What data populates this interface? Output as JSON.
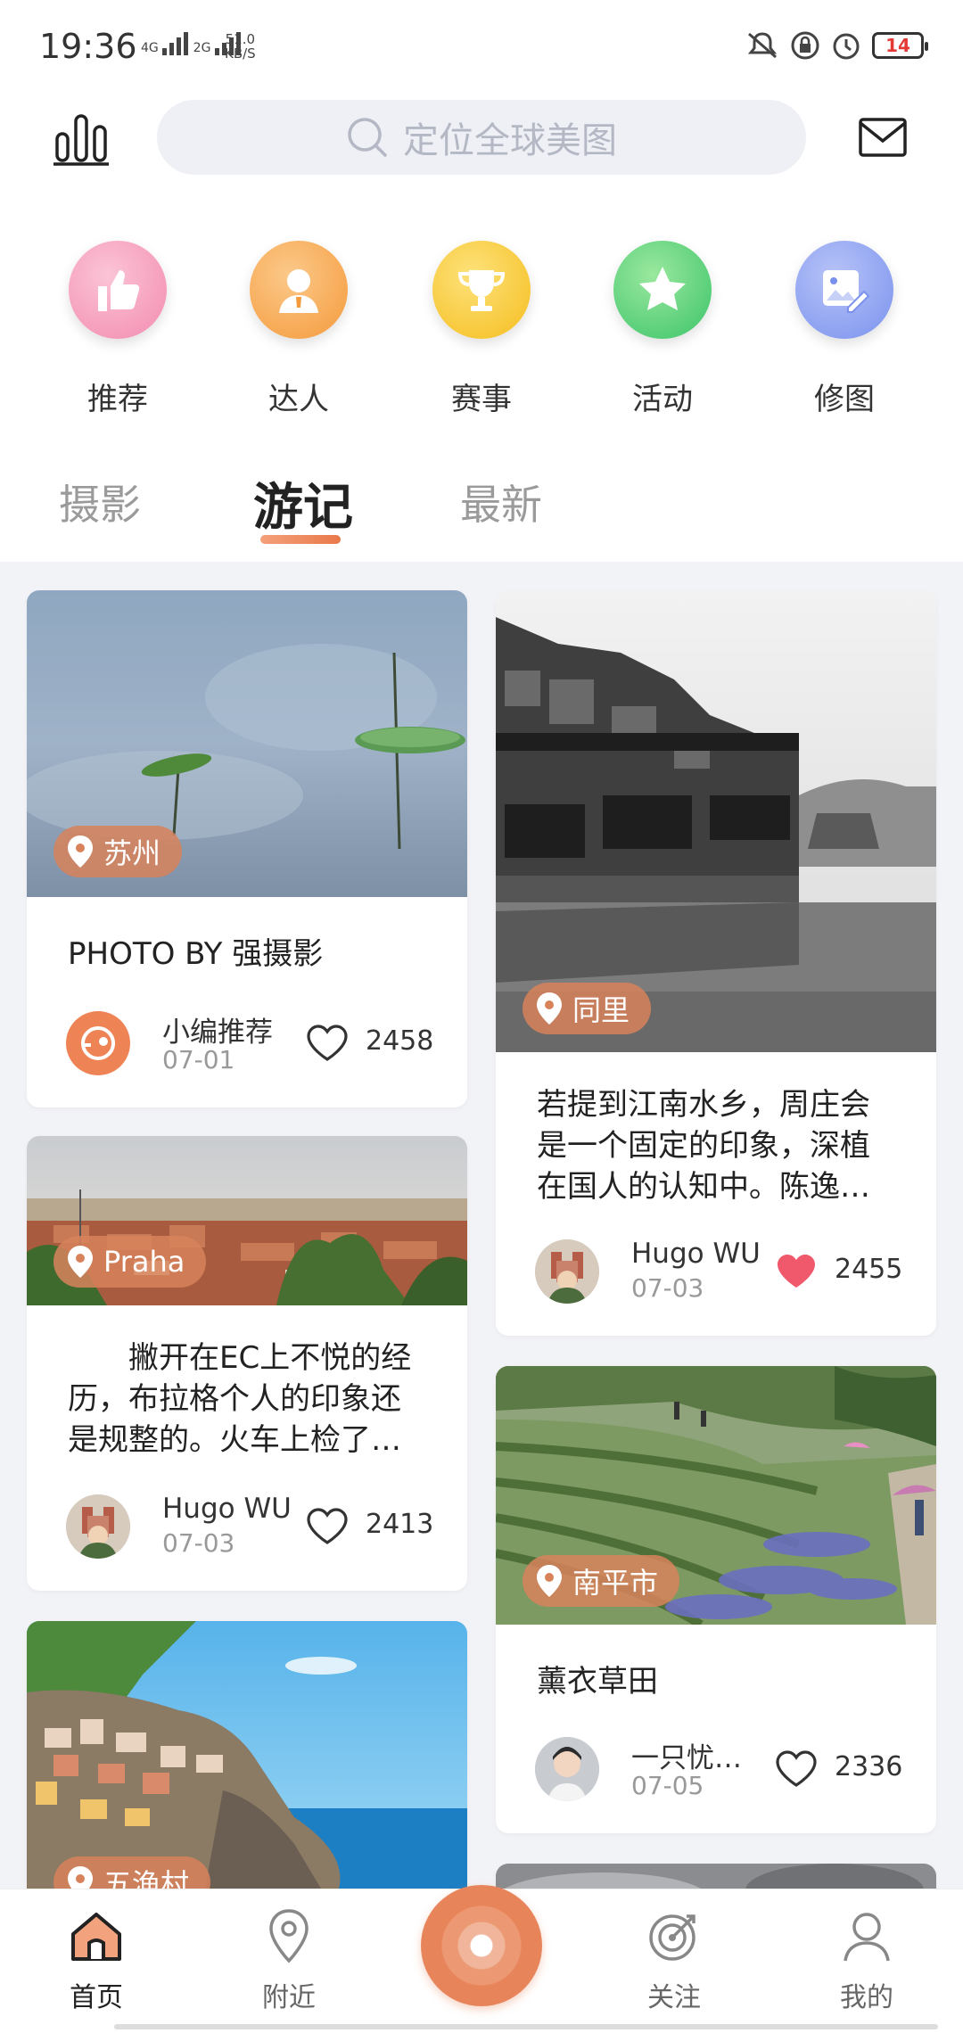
{
  "status_bar": {
    "time": "19:36",
    "network_left": "4G",
    "network_right": "2G",
    "speed_value": "51.0",
    "speed_unit": "KB/S",
    "battery": "14"
  },
  "header": {
    "search_placeholder": "定位全球美图"
  },
  "categories": [
    {
      "label": "推荐",
      "icon": "thumbs-up-icon",
      "color": "#f48fb1"
    },
    {
      "label": "达人",
      "icon": "person-icon",
      "color": "#f7a04b"
    },
    {
      "label": "赛事",
      "icon": "trophy-icon",
      "color": "#f7c531"
    },
    {
      "label": "活动",
      "icon": "star-icon",
      "color": "#4ccd6a"
    },
    {
      "label": "修图",
      "icon": "photo-edit-icon",
      "color": "#7d9bef"
    }
  ],
  "tabs": [
    {
      "label": "摄影"
    },
    {
      "label": "游记",
      "active": true
    },
    {
      "label": "最新"
    }
  ],
  "feed": {
    "left": [
      {
        "location": "苏州",
        "title": "PHOTO BY 强摄影",
        "author": "小编推荐",
        "date": "07-01",
        "likes": "2458",
        "liked": false
      },
      {
        "location": "Praha",
        "text": "　　撇开在EC上不悦的经历，布拉格个人的印象还是规整的。火车上检了…",
        "author": "Hugo WU",
        "date": "07-03",
        "likes": "2413",
        "liked": false
      },
      {
        "location": "五渔村"
      }
    ],
    "right": [
      {
        "location": "同里",
        "text": "若提到江南水乡，周庄会是一个固定的印象，深植在国人的认知中。陈逸…",
        "author": "Hugo WU",
        "date": "07-03",
        "likes": "2455",
        "liked": true
      },
      {
        "location": "南平市",
        "title": "薰衣草田",
        "author": "一只忧…",
        "date": "07-05",
        "likes": "2336",
        "liked": false
      }
    ]
  },
  "bottom_nav": [
    {
      "label": "首页",
      "icon": "home-icon",
      "active": true
    },
    {
      "label": "附近",
      "icon": "location-pin-icon"
    },
    {
      "label": "关注",
      "icon": "target-icon"
    },
    {
      "label": "我的",
      "icon": "profile-icon"
    }
  ],
  "colors": {
    "accent": "#e8845a",
    "like_active": "#f0596b"
  }
}
